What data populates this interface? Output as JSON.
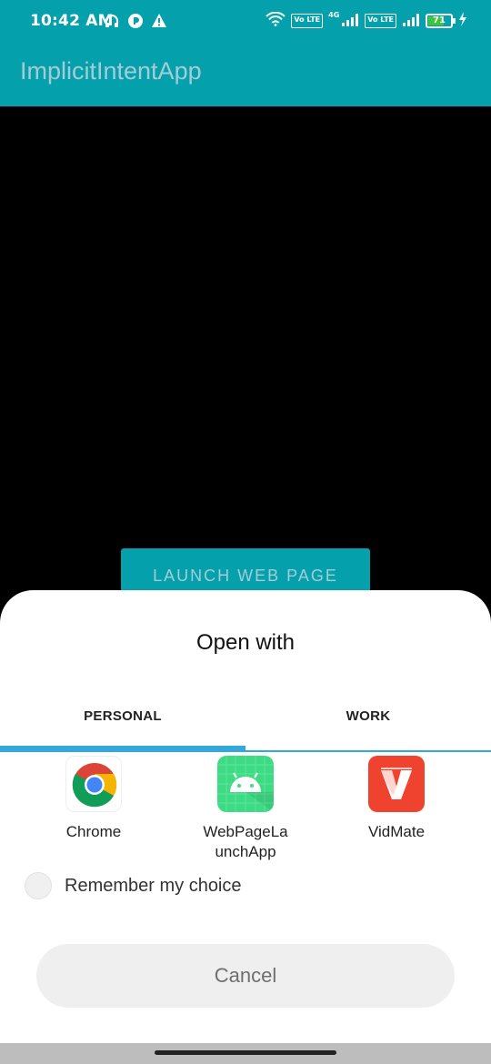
{
  "status_bar": {
    "time": "10:42 AM",
    "network_badge_1": "Vo LTE",
    "network_type": "4G",
    "network_badge_2": "Vo LTE",
    "battery_level": "71",
    "battery_fraction": 0.71,
    "icons": [
      "headphones-icon",
      "app-notification-icon",
      "warning-icon",
      "wifi-icon",
      "signal-icon",
      "charging-icon"
    ]
  },
  "app_bar": {
    "title": "ImplicitIntentApp"
  },
  "main": {
    "launch_button_label": "LAUNCH WEB PAGE"
  },
  "chooser": {
    "title": "Open with",
    "tabs": [
      {
        "label": "PERSONAL",
        "selected": true
      },
      {
        "label": "WORK",
        "selected": false
      }
    ],
    "apps": [
      {
        "label": "Chrome",
        "icon": "chrome-icon"
      },
      {
        "label": "WebPageLa\nunchApp",
        "icon": "android-icon"
      },
      {
        "label": "VidMate",
        "icon": "vidmate-icon"
      }
    ],
    "remember_label": "Remember my choice",
    "remember_checked": false,
    "cancel_label": "Cancel"
  },
  "colors": {
    "accent": "#04a1ac",
    "tab_indicator": "#33a8da",
    "sheet_bg": "#ffffff"
  }
}
